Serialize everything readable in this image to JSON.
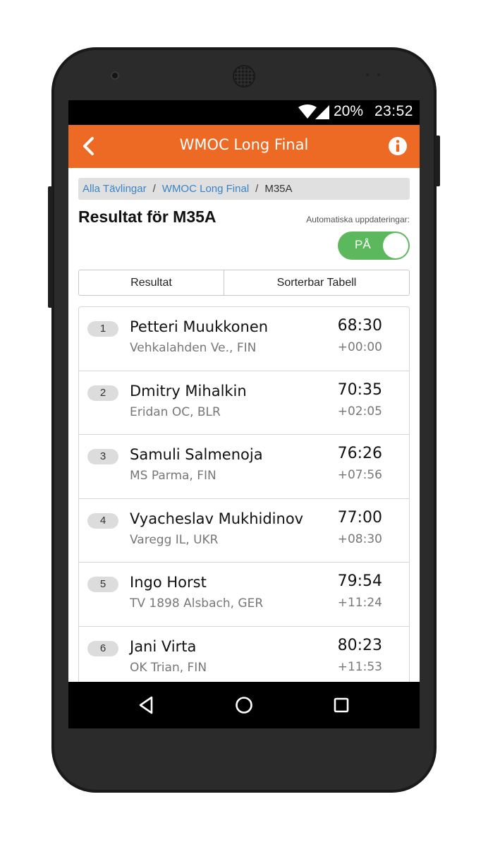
{
  "status_bar": {
    "battery": "20%",
    "time": "23:52",
    "icons": [
      "wifi-icon",
      "signal-icon"
    ]
  },
  "app_bar": {
    "title": "WMOC Long Final",
    "back_icon": "chevron-left-icon",
    "info_icon": "info-icon",
    "color": "#ec6a23"
  },
  "breadcrumb": {
    "items": [
      "Alla Tävlingar",
      "WMOC Long Final"
    ],
    "separator": "/",
    "current": "M35A"
  },
  "page": {
    "title": "Resultat för M35A",
    "auto_updates_label": "Automatiska uppdateringar:",
    "toggle_label": "PÅ",
    "toggle_on": true,
    "toggle_color": "#5bb85c"
  },
  "tabs": [
    "Resultat",
    "Sorterbar Tabell"
  ],
  "results": [
    {
      "rank": "1",
      "name": "Petteri Muukkonen",
      "club": "Vehkalahden Ve., FIN",
      "time": "68:30",
      "diff": "+00:00"
    },
    {
      "rank": "2",
      "name": "Dmitry Mihalkin",
      "club": "Eridan OC, BLR",
      "time": "70:35",
      "diff": "+02:05"
    },
    {
      "rank": "3",
      "name": "Samuli Salmenoja",
      "club": "MS Parma, FIN",
      "time": "76:26",
      "diff": "+07:56"
    },
    {
      "rank": "4",
      "name": "Vyacheslav Mukhidinov",
      "club": "Varegg IL, UKR",
      "time": "77:00",
      "diff": "+08:30"
    },
    {
      "rank": "5",
      "name": "Ingo Horst",
      "club": "TV 1898 Alsbach, GER",
      "time": "79:54",
      "diff": "+11:24"
    },
    {
      "rank": "6",
      "name": "Jani Virta",
      "club": "OK Trian, FIN",
      "time": "80:23",
      "diff": "+11:53"
    }
  ],
  "nav_bar": {
    "icons": [
      "back-triangle-icon",
      "home-circle-icon",
      "recents-square-icon"
    ]
  }
}
